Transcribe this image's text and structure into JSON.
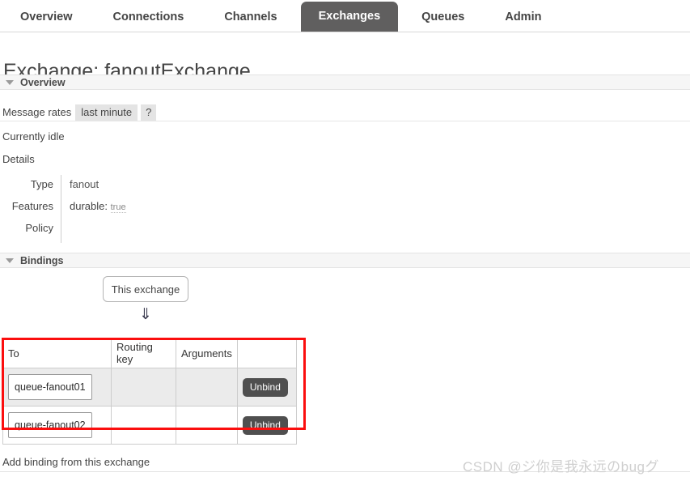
{
  "nav": {
    "tabs": [
      {
        "label": "Overview",
        "active": false
      },
      {
        "label": "Connections",
        "active": false
      },
      {
        "label": "Channels",
        "active": false
      },
      {
        "label": "Exchanges",
        "active": true
      },
      {
        "label": "Queues",
        "active": false
      },
      {
        "label": "Admin",
        "active": false
      }
    ]
  },
  "page": {
    "title": "Exchange: fanoutExchange"
  },
  "overview": {
    "section_title": "Overview",
    "rates_label": "Message rates",
    "rate_tabs": [
      {
        "label": "last minute"
      },
      {
        "label": "?"
      }
    ],
    "status_text": "Currently idle",
    "details_label": "Details",
    "details": [
      {
        "key": "Type",
        "value": "fanout"
      },
      {
        "key": "Features",
        "feature_name": "durable:",
        "feature_value": "true"
      },
      {
        "key": "Policy",
        "value": ""
      }
    ]
  },
  "bindings": {
    "section_title": "Bindings",
    "source_box_label": "This exchange",
    "arrow_glyph": "⇓",
    "columns": [
      "To",
      "Routing key",
      "Arguments",
      ""
    ],
    "rows": [
      {
        "to": "queue-fanout01",
        "routing_key": "",
        "arguments": "",
        "action": "Unbind"
      },
      {
        "to": "queue-fanout02",
        "routing_key": "",
        "arguments": "",
        "action": "Unbind"
      }
    ],
    "add_binding_label": "Add binding from this exchange",
    "highlight_color": "#fb0e0e"
  },
  "watermark": {
    "text": "CSDN @ジ你是我永远のbugグ"
  }
}
